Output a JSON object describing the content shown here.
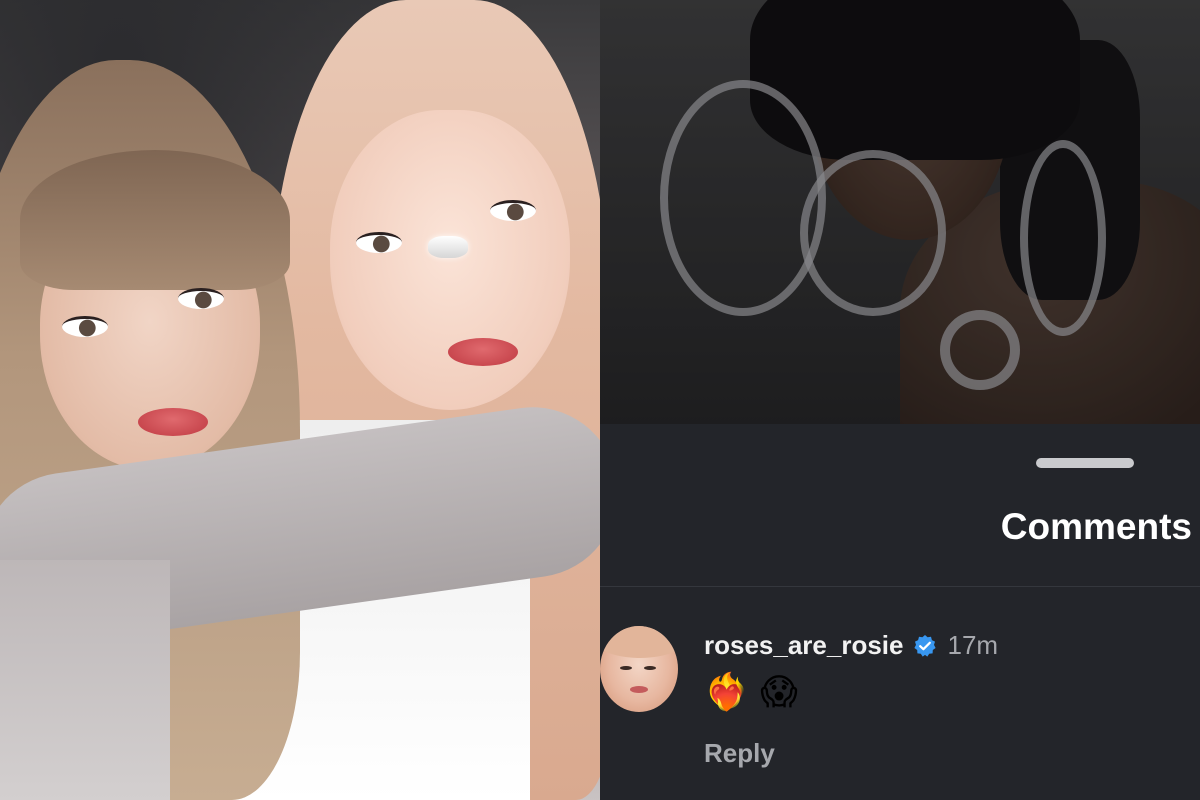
{
  "comments_sheet": {
    "title": "Comments"
  },
  "comment": {
    "username": "roses_are_rosie",
    "verified": true,
    "verified_icon": "verified-badge-icon",
    "timestamp": "17m",
    "body": "❤️‍🔥 😱",
    "reply_label": "Reply"
  },
  "colors": {
    "sheet_background": "#23252a",
    "verified_blue": "#3897f0",
    "text_primary": "#ffffff",
    "text_secondary": "#a6a8ad"
  }
}
